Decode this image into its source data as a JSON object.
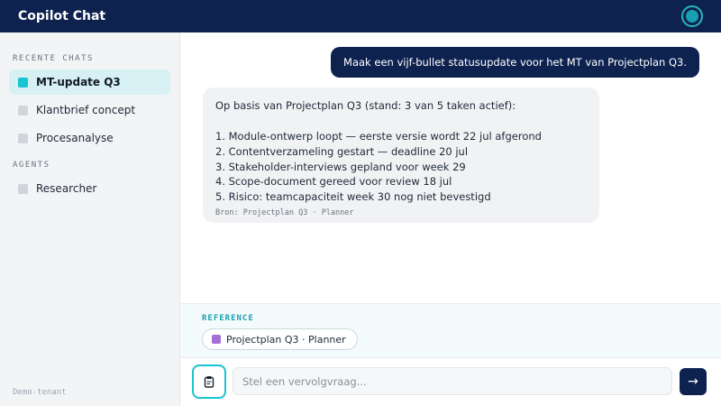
{
  "header": {
    "title": "Copilot Chat",
    "avatar_icon": "user-avatar-icon"
  },
  "sidebar": {
    "recent_label": "RECENTE CHATS",
    "recent_items": [
      {
        "label": "MT-update Q3",
        "active": true
      },
      {
        "label": "Klantbrief concept",
        "active": false
      },
      {
        "label": "Procesanalyse",
        "active": false
      }
    ],
    "agents_label": "AGENTS",
    "agent_items": [
      {
        "label": "Researcher"
      }
    ],
    "tenant": "Demo-tenant"
  },
  "chat": {
    "user_message": "Maak een vijf-bullet statusupdate voor het MT van Projectplan Q3.",
    "assistant": {
      "intro": "Op basis van Projectplan Q3 (stand: 3 van 5 taken actief):",
      "bullets": [
        "1. Module-ontwerp loopt — eerste versie wordt 22 jul afgerond",
        "2. Contentverzameling gestart — deadline 20 jul",
        "3. Stakeholder-interviews gepland voor week 29",
        "4. Scope-document gereed voor review 18 jul",
        "5. Risico: teamcapaciteit week 30 nog niet bevestigd"
      ],
      "source": "Bron: Projectplan Q3 · Planner"
    }
  },
  "reference": {
    "label": "REFERENCE",
    "chip": "Projectplan Q3 · Planner"
  },
  "composer": {
    "placeholder": "Stel een vervolgvraag...",
    "value": "",
    "attach_icon": "clipboard-icon",
    "send_icon": "arrow-right-icon",
    "send_glyph": "→"
  },
  "colors": {
    "navy": "#0e2250",
    "accent": "#18c4cf",
    "reference_chip": "#a470d8"
  }
}
